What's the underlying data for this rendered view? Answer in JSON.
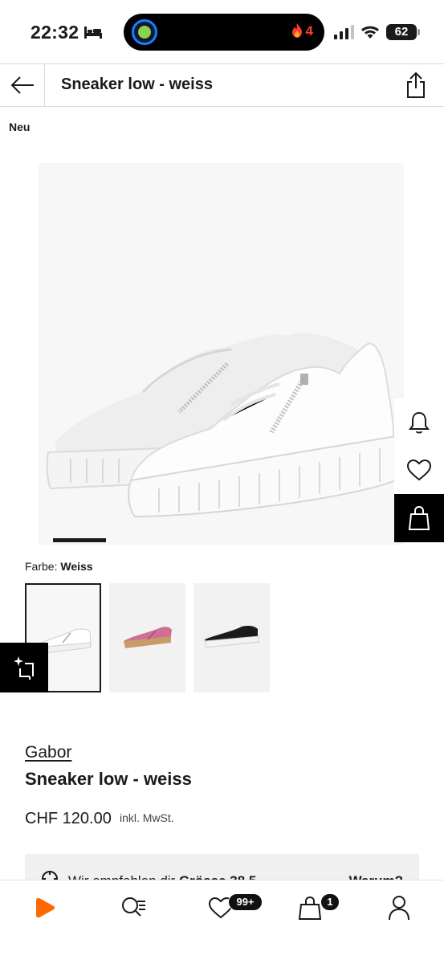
{
  "status_bar": {
    "time": "22:32",
    "notification_count": "4",
    "battery": "62"
  },
  "header": {
    "title": "Sneaker low - weiss"
  },
  "badge": "Neu",
  "gallery": {
    "active_index": 0
  },
  "color": {
    "label": "Farbe:",
    "value": "Weiss",
    "swatches": [
      {
        "name": "white",
        "color": "#ffffff"
      },
      {
        "name": "pink",
        "color": "#cf6f96"
      },
      {
        "name": "black",
        "color": "#1b1b1b"
      }
    ],
    "selected_index": 0
  },
  "product": {
    "brand": "Gabor",
    "name": "Sneaker low - weiss",
    "price": "CHF 120.00",
    "tax_note": "inkl. MwSt."
  },
  "size_recommendation": {
    "text": "Wir empfehlen dir",
    "size": "Grösse 38.5",
    "why": "Warum?"
  },
  "bottom_nav": {
    "wishlist_badge": "99+",
    "cart_badge": "1"
  },
  "colors": {
    "accent": "#ff6900",
    "dark": "#1a1a1a",
    "notification_red": "#ff3a30"
  }
}
